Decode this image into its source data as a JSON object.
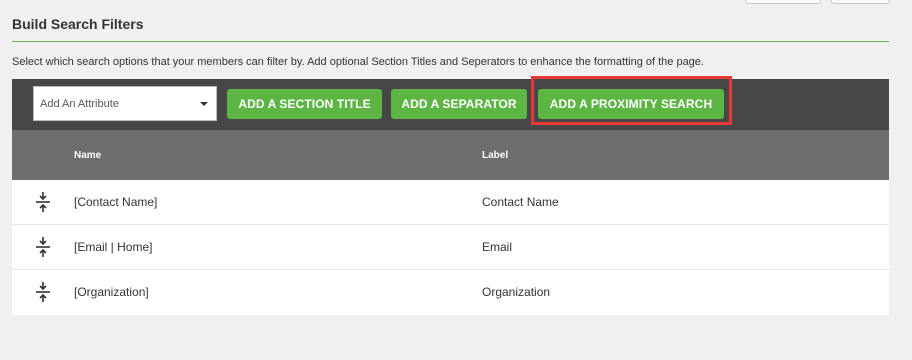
{
  "section": {
    "title": "Build Search Filters",
    "description": "Select which search options that your members can filter by. Add optional Section Titles and Seperators to enhance the formatting of the page."
  },
  "toolbar": {
    "attribute_placeholder": "Add An Attribute",
    "add_section_title_label": "ADD A SECTION TITLE",
    "add_separator_label": "ADD A SEPARATOR",
    "add_proximity_search_label": "ADD A PROXIMITY SEARCH"
  },
  "table": {
    "columns": [
      "Name",
      "Label"
    ],
    "rows": [
      {
        "name": "[Contact Name]",
        "label": "Contact Name"
      },
      {
        "name": "[Email | Home]",
        "label": "Email"
      },
      {
        "name": "[Organization]",
        "label": "Organization"
      }
    ]
  },
  "colors": {
    "accent_green": "#5db543",
    "highlight_red": "#e53935",
    "toolbar_bg": "#474747",
    "header_bg": "#6e6e6e"
  },
  "icons": {
    "drag": "drag-handle-icon",
    "dropdown": "chevron-down-icon"
  }
}
